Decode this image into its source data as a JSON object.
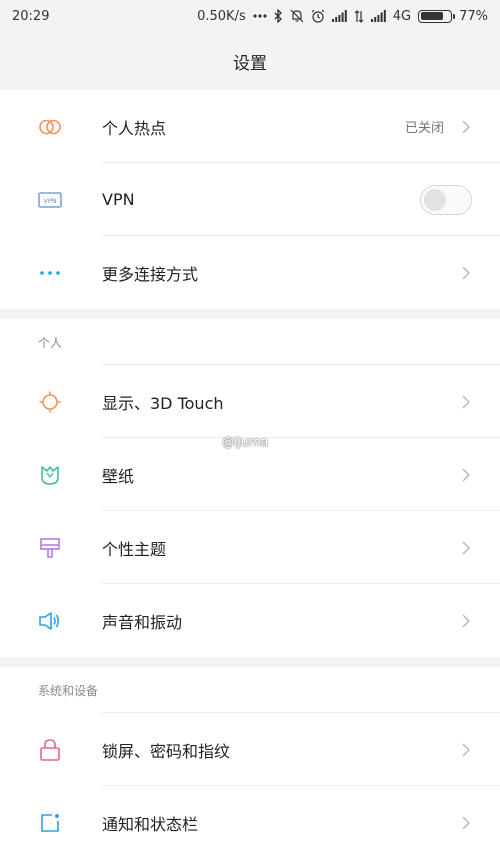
{
  "status_bar": {
    "time": "20:29",
    "speed": "0.50K/s",
    "network": "4G",
    "battery": "77%",
    "battery_level": 0.77
  },
  "header": {
    "title": "设置"
  },
  "section_top": {
    "items": [
      {
        "icon": "hotspot-icon",
        "label": "个人热点",
        "value": "已关闭",
        "kind": "chevron"
      },
      {
        "icon": "vpn-icon",
        "label": "VPN",
        "kind": "toggle",
        "toggle_on": false
      },
      {
        "icon": "more-dots-icon",
        "label": "更多连接方式",
        "kind": "chevron"
      }
    ]
  },
  "section_personal": {
    "header": "个人",
    "items": [
      {
        "icon": "sun-icon",
        "label": "显示、3D Touch"
      },
      {
        "icon": "wallpaper-icon",
        "label": "壁纸"
      },
      {
        "icon": "theme-brush-icon",
        "label": "个性主题"
      },
      {
        "icon": "speaker-icon",
        "label": "声音和振动"
      }
    ]
  },
  "section_system": {
    "header": "系统和设备",
    "items": [
      {
        "icon": "lock-icon",
        "label": "锁屏、密码和指纹"
      },
      {
        "icon": "notification-icon",
        "label": "通知和状态栏"
      }
    ]
  },
  "watermark": "@iJurna",
  "colors": {
    "hotspot": "#f0915a",
    "vpn": "#5f8fd6",
    "more": "#2aa4e0",
    "sun": "#f0915a",
    "wallpaper": "#3dbfa0",
    "theme": "#b47be0",
    "speaker": "#2aa4e0",
    "lock": "#e5677c",
    "notification": "#2aa4e0"
  }
}
